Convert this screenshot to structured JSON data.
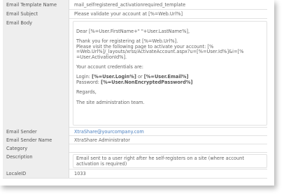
{
  "fields": {
    "template_name": {
      "label": "Email Template Name",
      "value": "mail_selfregistered_activationrequired_template"
    },
    "subject": {
      "label": "Email Subject",
      "value": "Please validate your account at [%=Web.Url%]"
    },
    "body": {
      "label": "Email Body",
      "greeting": "Dear [%=User.FirstName+\" \"+User.LastName%],",
      "thanks": "Thank you for registering at [%=Web.Url%].",
      "visit_1": "Please visit the following page to activate your account: [%",
      "visit_2": "=Web.Url%]/_layouts/xrss/ActivateAccount.aspx?u=[%=User.Id%]&i=[%",
      "visit_3": "=User.ActivationId%].",
      "credentials": "Your account credentials are:",
      "login_prefix": "Login: ",
      "login_value": "[%=User.Login%]",
      "login_or": " or ",
      "email_value": "[%=User.Email%]",
      "password_prefix": "Password: ",
      "password_value": "[%=User.NonEncryptedPassword%]",
      "regards": "Regards,",
      "signature": "The site administration team."
    },
    "sender": {
      "label": "Email Sender",
      "value": "XtraShare@yourcompany.com",
      "color": "#4a7fbf"
    },
    "sender_name": {
      "label": "Email Sender Name",
      "value": "XtraShare Administrator"
    },
    "category": {
      "label": "Category",
      "value": ""
    },
    "description": {
      "label": "Description",
      "value": "Email sent to a user right after he self-registers on a site (where account activation is required)"
    },
    "locale": {
      "label": "LocaleID",
      "value": "1033"
    }
  }
}
